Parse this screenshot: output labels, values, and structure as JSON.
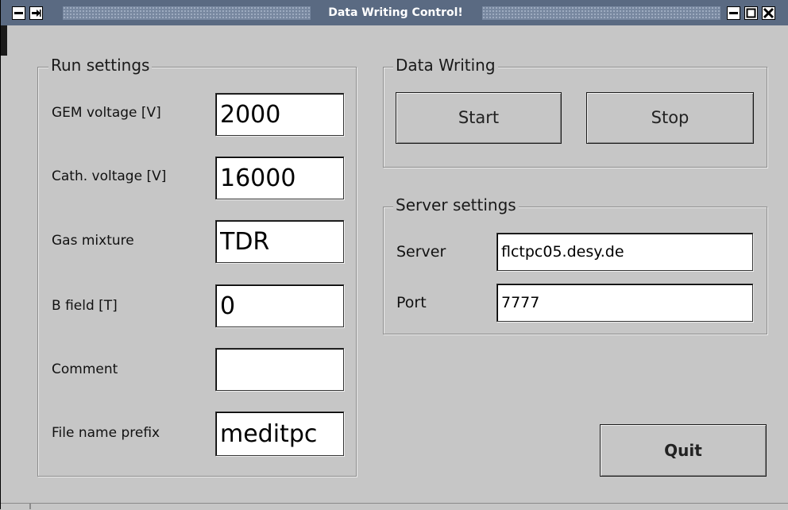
{
  "window": {
    "title": "Data Writing Control!"
  },
  "run_settings": {
    "legend": "Run settings",
    "fields": [
      {
        "label": "GEM voltage [V]",
        "value": "2000"
      },
      {
        "label": "Cath. voltage [V]",
        "value": "16000"
      },
      {
        "label": "Gas mixture",
        "value": "TDR"
      },
      {
        "label": "B field [T]",
        "value": "0"
      },
      {
        "label": "Comment",
        "value": ""
      },
      {
        "label": "File name prefix",
        "value": "meditpc"
      }
    ]
  },
  "data_writing": {
    "legend": "Data Writing",
    "start_label": "Start",
    "stop_label": "Stop"
  },
  "server_settings": {
    "legend": "Server settings",
    "server_label": "Server",
    "server_value": "flctpc05.desy.de",
    "port_label": "Port",
    "port_value": "7777"
  },
  "quit_label": "Quit",
  "icons": {
    "window_menu": "minus-icon",
    "pin": "pin-icon",
    "minimize": "minimize-icon",
    "maximize": "maximize-icon",
    "close": "close-icon"
  }
}
